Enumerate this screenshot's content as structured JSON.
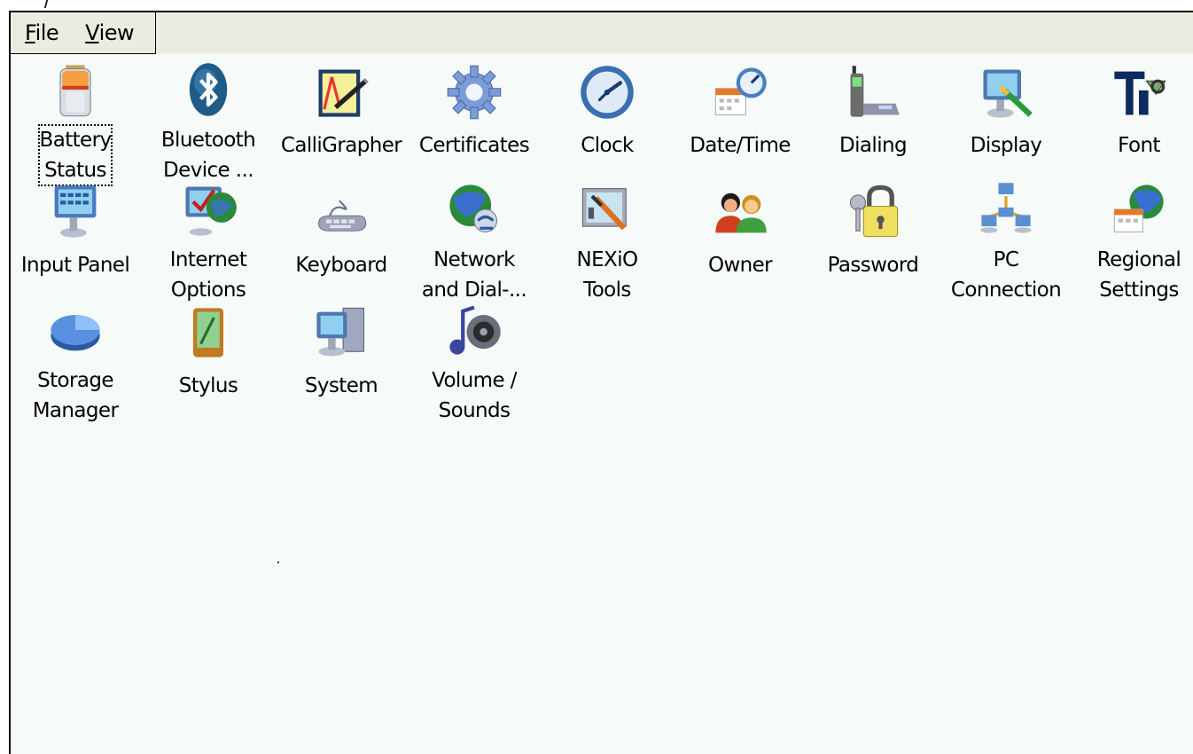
{
  "menu": {
    "file": "File",
    "view": "View"
  },
  "items": [
    {
      "line1": "Battery",
      "line2": "Status",
      "icon": "battery-icon"
    },
    {
      "line1": "Bluetooth",
      "line2": "Device ...",
      "icon": "bluetooth-icon"
    },
    {
      "line1": "CalliGrapher",
      "line2": "",
      "icon": "calligrapher-icon"
    },
    {
      "line1": "Certificates",
      "line2": "",
      "icon": "certificates-icon"
    },
    {
      "line1": "Clock",
      "line2": "",
      "icon": "clock-icon"
    },
    {
      "line1": "Date/Time",
      "line2": "",
      "icon": "datetime-icon"
    },
    {
      "line1": "Dialing",
      "line2": "",
      "icon": "dialing-icon"
    },
    {
      "line1": "Display",
      "line2": "",
      "icon": "display-icon"
    },
    {
      "line1": "Font",
      "line2": "",
      "icon": "font-icon"
    },
    {
      "line1": "Input Panel",
      "line2": "",
      "icon": "input-panel-icon"
    },
    {
      "line1": "Internet",
      "line2": "Options",
      "icon": "internet-options-icon"
    },
    {
      "line1": "Keyboard",
      "line2": "",
      "icon": "keyboard-icon"
    },
    {
      "line1": "Network",
      "line2": "and Dial-...",
      "icon": "network-icon"
    },
    {
      "line1": "NEXiO",
      "line2": "Tools",
      "icon": "nexio-tools-icon"
    },
    {
      "line1": "Owner",
      "line2": "",
      "icon": "owner-icon"
    },
    {
      "line1": "Password",
      "line2": "",
      "icon": "password-icon"
    },
    {
      "line1": "PC",
      "line2": "Connection",
      "icon": "pc-connection-icon"
    },
    {
      "line1": "Regional",
      "line2": "Settings",
      "icon": "regional-settings-icon"
    },
    {
      "line1": "Storage",
      "line2": "Manager",
      "icon": "storage-manager-icon"
    },
    {
      "line1": "Stylus",
      "line2": "",
      "icon": "stylus-icon"
    },
    {
      "line1": "System",
      "line2": "",
      "icon": "system-icon"
    },
    {
      "line1": "Volume /",
      "line2": "Sounds",
      "icon": "volume-sounds-icon"
    }
  ]
}
